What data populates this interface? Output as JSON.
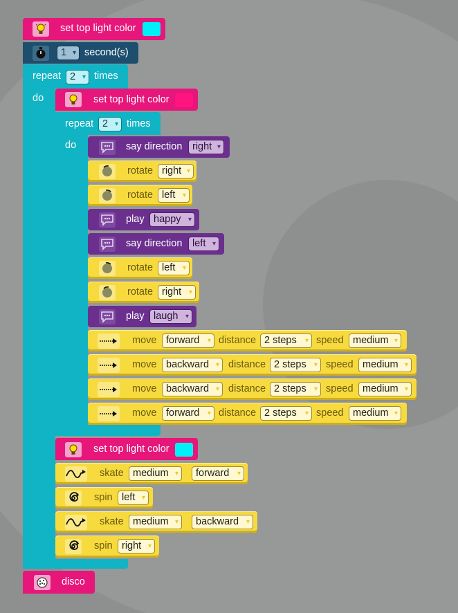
{
  "blocks": {
    "top_light_1": {
      "label": "set top light color",
      "color": "#00f0f8"
    },
    "wait": {
      "value": "1",
      "unit": "second(s)"
    },
    "repeat_outer": {
      "prefix": "repeat",
      "count": "2",
      "suffix": "times",
      "do": "do"
    },
    "top_light_2": {
      "label": "set top light color",
      "color": "#ff1480"
    },
    "repeat_inner": {
      "prefix": "repeat",
      "count": "2",
      "suffix": "times",
      "do": "do"
    },
    "say_1": {
      "label": "say direction",
      "value": "right"
    },
    "rotate_1": {
      "label": "rotate",
      "value": "right"
    },
    "rotate_2": {
      "label": "rotate",
      "value": "left"
    },
    "play_1": {
      "label": "play",
      "value": "happy"
    },
    "say_2": {
      "label": "say direction",
      "value": "left"
    },
    "rotate_3": {
      "label": "rotate",
      "value": "left"
    },
    "rotate_4": {
      "label": "rotate",
      "value": "right"
    },
    "play_2": {
      "label": "play",
      "value": "laugh"
    },
    "move_1": {
      "label": "move",
      "direction": "forward",
      "distance_label": "distance",
      "distance": "2 steps",
      "speed_label": "speed",
      "speed": "medium"
    },
    "move_2": {
      "label": "move",
      "direction": "backward",
      "distance_label": "distance",
      "distance": "2 steps",
      "speed_label": "speed",
      "speed": "medium"
    },
    "move_3": {
      "label": "move",
      "direction": "backward",
      "distance_label": "distance",
      "distance": "2 steps",
      "speed_label": "speed",
      "speed": "medium"
    },
    "move_4": {
      "label": "move",
      "direction": "forward",
      "distance_label": "distance",
      "distance": "2 steps",
      "speed_label": "speed",
      "speed": "medium"
    },
    "top_light_3": {
      "label": "set top light color",
      "color": "#00f0f8"
    },
    "skate_1": {
      "label": "skate",
      "speed": "medium",
      "direction": "forward"
    },
    "spin_1": {
      "label": "spin",
      "value": "left"
    },
    "skate_2": {
      "label": "skate",
      "speed": "medium",
      "direction": "backward"
    },
    "spin_2": {
      "label": "spin",
      "value": "right"
    },
    "disco": {
      "label": "disco"
    }
  },
  "dropdown_arrow": "▾",
  "icons": {
    "light": "light-bulb-icon",
    "timer": "stopwatch-icon",
    "speech": "speech-bubble-icon",
    "rotate": "rotate-icon",
    "move": "arrow-right-icon",
    "skate": "wave-icon",
    "spin": "spiral-icon",
    "disco": "disco-ball-icon"
  }
}
